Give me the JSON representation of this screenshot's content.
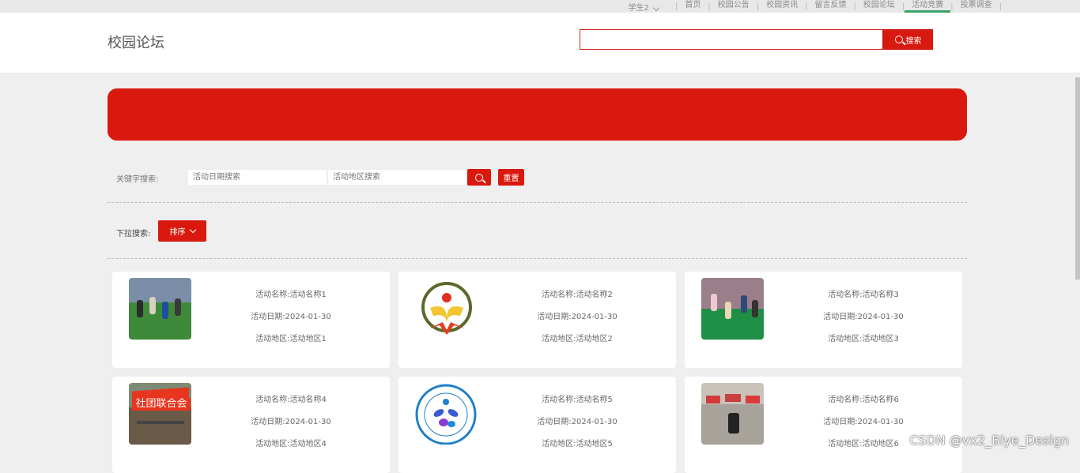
{
  "topnav": {
    "user": "学生2",
    "items": [
      "首页",
      "校园公告",
      "校园资讯",
      "留言反馈",
      "校园论坛",
      "活动竞赛",
      "投票调查"
    ],
    "active_index": 5
  },
  "header": {
    "site_title": "校园论坛",
    "search_value": "",
    "search_button": "搜索"
  },
  "filters": {
    "keyword_label": "关键字搜索:",
    "date_placeholder": "活动日期搜索",
    "location_placeholder": "活动地区搜索",
    "reset_label": "重置",
    "dropdown_label": "下拉搜索:",
    "sort_label": "排序"
  },
  "cards": [
    {
      "name": "活动名称:活动名称1",
      "date": "活动日期:2024-01-30",
      "location": "活动地区:活动地区1"
    },
    {
      "name": "活动名称:活动名称2",
      "date": "活动日期:2024-01-30",
      "location": "活动地区:活动地区2"
    },
    {
      "name": "活动名称:活动名称3",
      "date": "活动日期:2024-01-30",
      "location": "活动地区:活动地区3"
    },
    {
      "name": "活动名称:活动名称4",
      "date": "活动日期:2024-01-30",
      "location": "活动地区:活动地区4"
    },
    {
      "name": "活动名称:活动名称5",
      "date": "活动日期:2024-01-30",
      "location": "活动地区:活动地区5"
    },
    {
      "name": "活动名称:活动名称6",
      "date": "活动日期:2024-01-30",
      "location": "活动地区:活动地区6"
    }
  ],
  "thumb_texts": {
    "club_banner": "社团联合会"
  },
  "watermark": "CSDN @vx2_Biye_Design",
  "colors": {
    "accent": "#d9190d",
    "nav_active": "#3aa36b",
    "page_bg": "#efefef"
  }
}
